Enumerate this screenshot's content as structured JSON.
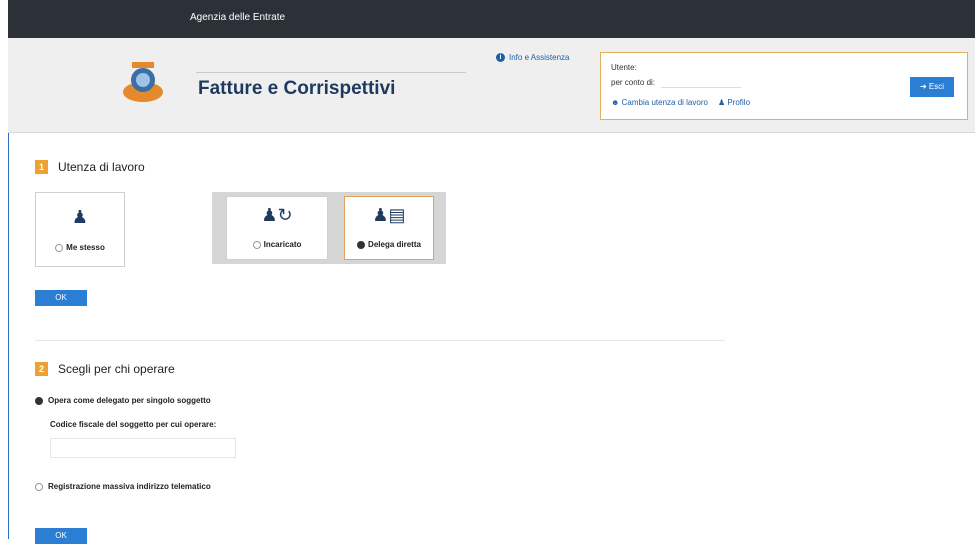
{
  "topbar": {
    "title": "Agenzia delle Entrate"
  },
  "header": {
    "app_title": "Fatture e Corrispettivi",
    "info_link": "Info e Assistenza",
    "user": {
      "utente_label": "Utente:",
      "per_conto_label": "per conto di:",
      "change_link": "Cambia utenza di lavoro",
      "profile_link": "Profilo",
      "exit_label": "Esci"
    }
  },
  "step1": {
    "number": "1",
    "title": "Utenza di lavoro",
    "options": [
      {
        "label": "Me stesso",
        "selected": false
      },
      {
        "label": "Incaricato",
        "selected": false
      },
      {
        "label": "Delega diretta",
        "selected": true
      }
    ],
    "ok_label": "OK"
  },
  "step2": {
    "number": "2",
    "title": "Scegli per chi operare",
    "option_single": "Opera come delegato per singolo soggetto",
    "cf_label": "Codice fiscale del soggetto per cui operare:",
    "cf_value": "",
    "option_massive": "Registrazione massiva indirizzo telematico",
    "ok_label": "OK"
  },
  "colors": {
    "accent": "#2a7fd4",
    "step_badge": "#f0a030",
    "topbar": "#2c3138"
  }
}
